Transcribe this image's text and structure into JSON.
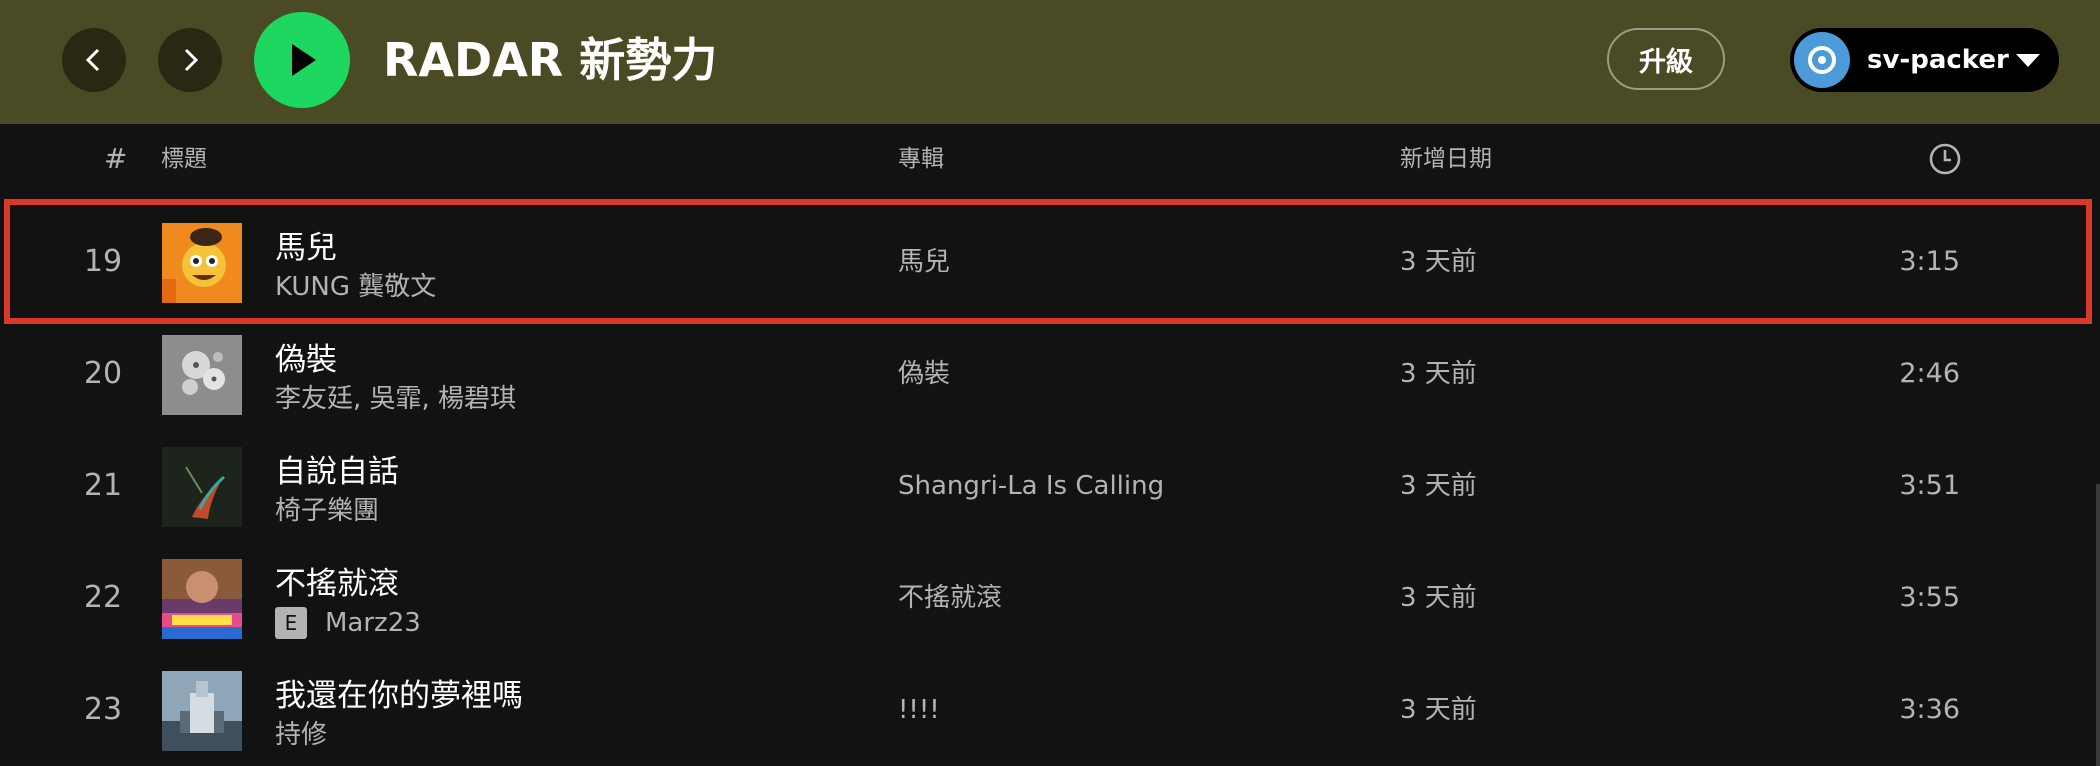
{
  "topbar": {
    "title": "RADAR 新勢力",
    "upgrade_label": "升級",
    "username": "sv-packer",
    "icons": [
      "chevron-left-icon",
      "chevron-right-icon",
      "play-icon",
      "user-icon",
      "caret-down-icon"
    ],
    "colors": {
      "bar": "#4a4a24",
      "play": "#1ed760",
      "avatar": "#4c9ad8"
    }
  },
  "table": {
    "headers": {
      "number": "#",
      "title": "標題",
      "album": "專輯",
      "date_added": "新增日期",
      "duration_icon": "clock-icon"
    },
    "rows": [
      {
        "num": "19",
        "title": "馬兒",
        "artist": "KUNG 龔敬文",
        "explicit": false,
        "album": "馬兒",
        "added": "3 天前",
        "duration": "3:15",
        "highlighted": true
      },
      {
        "num": "20",
        "title": "偽裝",
        "artist": "李友廷, 吳霏, 楊碧琪",
        "explicit": false,
        "album": "偽裝",
        "added": "3 天前",
        "duration": "2:46",
        "highlighted": false
      },
      {
        "num": "21",
        "title": "自說自話",
        "artist": "椅子樂團",
        "explicit": false,
        "album": "Shangri-La Is Calling",
        "added": "3 天前",
        "duration": "3:51",
        "highlighted": false
      },
      {
        "num": "22",
        "title": "不搖就滾",
        "artist": "Marz23",
        "explicit": true,
        "explicit_label": "E",
        "album": "不搖就滾",
        "added": "3 天前",
        "duration": "3:55",
        "highlighted": false
      },
      {
        "num": "23",
        "title": "我還在你的夢裡嗎",
        "artist": "持修",
        "explicit": false,
        "album": "!!!!",
        "added": "3 天前",
        "duration": "3:36",
        "highlighted": false
      }
    ]
  },
  "highlight_color": "#d8392b"
}
